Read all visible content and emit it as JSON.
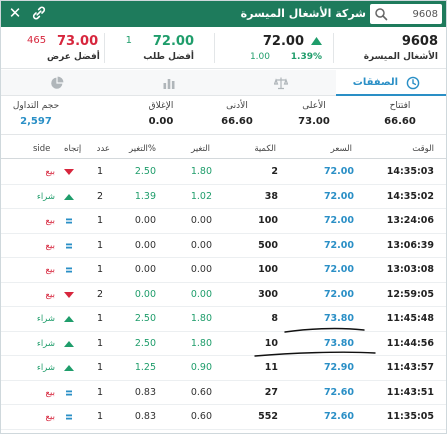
{
  "header": {
    "title": "شركة الأشغال الميسرة",
    "search_value": "9608"
  },
  "quote": {
    "symbol": "9608",
    "name": "الأشغال الميسرة",
    "last_price": "72.00",
    "change": "1.00",
    "change_pct": "1.39%",
    "best_bid_qty": "1",
    "best_bid_price": "72.00",
    "best_bid_label": "أفضل طلب",
    "best_ask_qty": "465",
    "best_ask_price": "73.00",
    "best_ask_label": "أفضل عرض",
    "colors": {
      "up": "#1f9d6b",
      "down": "#d7263d",
      "accent": "#2a8fc6",
      "header": "#1e7b5c"
    }
  },
  "tabs": [
    {
      "label": "الصفقات",
      "icon": "clock-icon",
      "active": true
    },
    {
      "label": "",
      "icon": "scales-icon",
      "active": false
    },
    {
      "label": "",
      "icon": "bar-chart-icon",
      "active": false
    },
    {
      "label": "",
      "icon": "pie-chart-icon",
      "active": false
    }
  ],
  "stats": [
    {
      "label": "افتتاح",
      "value": "66.60"
    },
    {
      "label": "الأعلى",
      "value": "73.00"
    },
    {
      "label": "الأدنى",
      "value": "66.60"
    },
    {
      "label": "الإغلاق",
      "value": "0.00"
    },
    {
      "label": "حجم التداول",
      "value": "2,597"
    }
  ],
  "table": {
    "headers": {
      "time": "الوقت",
      "price": "السعر",
      "qty": "الكمية",
      "chg": "التغير",
      "pct": "التغير%",
      "cnt": "عدد",
      "dir": "إتجاه",
      "side": "side"
    },
    "rows": [
      {
        "time": "14:35:03",
        "price": "72.00",
        "qty": "2",
        "chg": "1.80",
        "pct": "2.50",
        "cnt": "1",
        "dir": "down",
        "side": "بيع"
      },
      {
        "time": "14:35:02",
        "price": "72.00",
        "qty": "38",
        "chg": "1.02",
        "pct": "1.39",
        "cnt": "2",
        "dir": "up",
        "side": "شراء"
      },
      {
        "time": "13:24:06",
        "price": "72.00",
        "qty": "100",
        "chg": "0.00",
        "pct": "0.00",
        "cnt": "1",
        "dir": "neutral",
        "side": "بيع"
      },
      {
        "time": "13:06:39",
        "price": "72.00",
        "qty": "500",
        "chg": "0.00",
        "pct": "0.00",
        "cnt": "1",
        "dir": "neutral",
        "side": "بيع"
      },
      {
        "time": "13:03:08",
        "price": "72.00",
        "qty": "100",
        "chg": "0.00",
        "pct": "0.00",
        "cnt": "1",
        "dir": "neutral",
        "side": "بيع"
      },
      {
        "time": "12:59:05",
        "price": "72.00",
        "qty": "300",
        "chg": "0.00",
        "pct": "0.00",
        "cnt": "2",
        "dir": "down",
        "side": "بيع"
      },
      {
        "time": "11:45:48",
        "price": "73.80",
        "qty": "8",
        "chg": "1.80",
        "pct": "2.50",
        "cnt": "1",
        "dir": "up",
        "side": "شراء"
      },
      {
        "time": "11:44:56",
        "price": "73.80",
        "qty": "10",
        "chg": "1.80",
        "pct": "2.50",
        "cnt": "1",
        "dir": "up",
        "side": "شراء"
      },
      {
        "time": "11:43:57",
        "price": "72.90",
        "qty": "11",
        "chg": "0.90",
        "pct": "1.25",
        "cnt": "1",
        "dir": "up",
        "side": "شراء"
      },
      {
        "time": "11:43:51",
        "price": "72.60",
        "qty": "27",
        "chg": "0.60",
        "pct": "0.83",
        "cnt": "1",
        "dir": "neutral",
        "side": "بيع"
      },
      {
        "time": "11:35:05",
        "price": "72.60",
        "qty": "552",
        "chg": "0.60",
        "pct": "0.83",
        "cnt": "1",
        "dir": "neutral",
        "side": "بيع"
      }
    ]
  }
}
